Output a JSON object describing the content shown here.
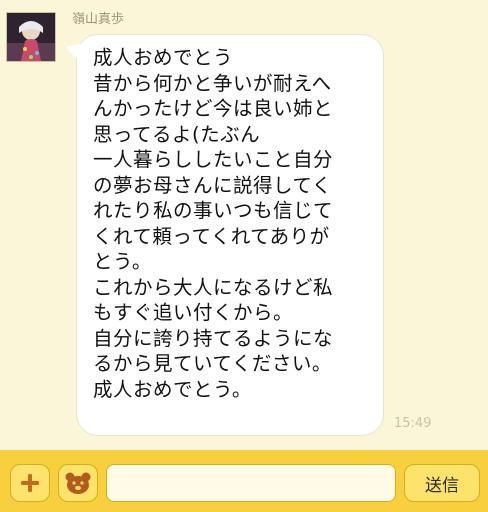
{
  "chat": {
    "sender_name": "嶺山真歩",
    "message_lines": [
      "成人おめでとう",
      "昔から何かと争いが耐えへ",
      "んかったけど今は良い姉と",
      "思ってるよ(たぶん",
      "一人暮らししたいこと自分",
      "の夢お母さんに説得してく",
      "れたり私の事いつも信じて",
      "くれて頼ってくれてありが",
      "とう。",
      "これから大人になるけど私",
      "もすぐ追い付くから。",
      "自分に誇り持てるようにな",
      "るから見ていてください。",
      "成人おめでとう。"
    ],
    "time": "15:49"
  },
  "composer": {
    "plus_icon": "plus-icon",
    "bear_icon": "bear-sticker-icon",
    "input_placeholder": "",
    "send_label": "送信"
  },
  "colors": {
    "background": "#fbf6d7",
    "bar": "#f7cf3f",
    "button": "#fde36b",
    "plus_icon_color": "#c26a1d",
    "bear_icon_color": "#b35b1a"
  }
}
